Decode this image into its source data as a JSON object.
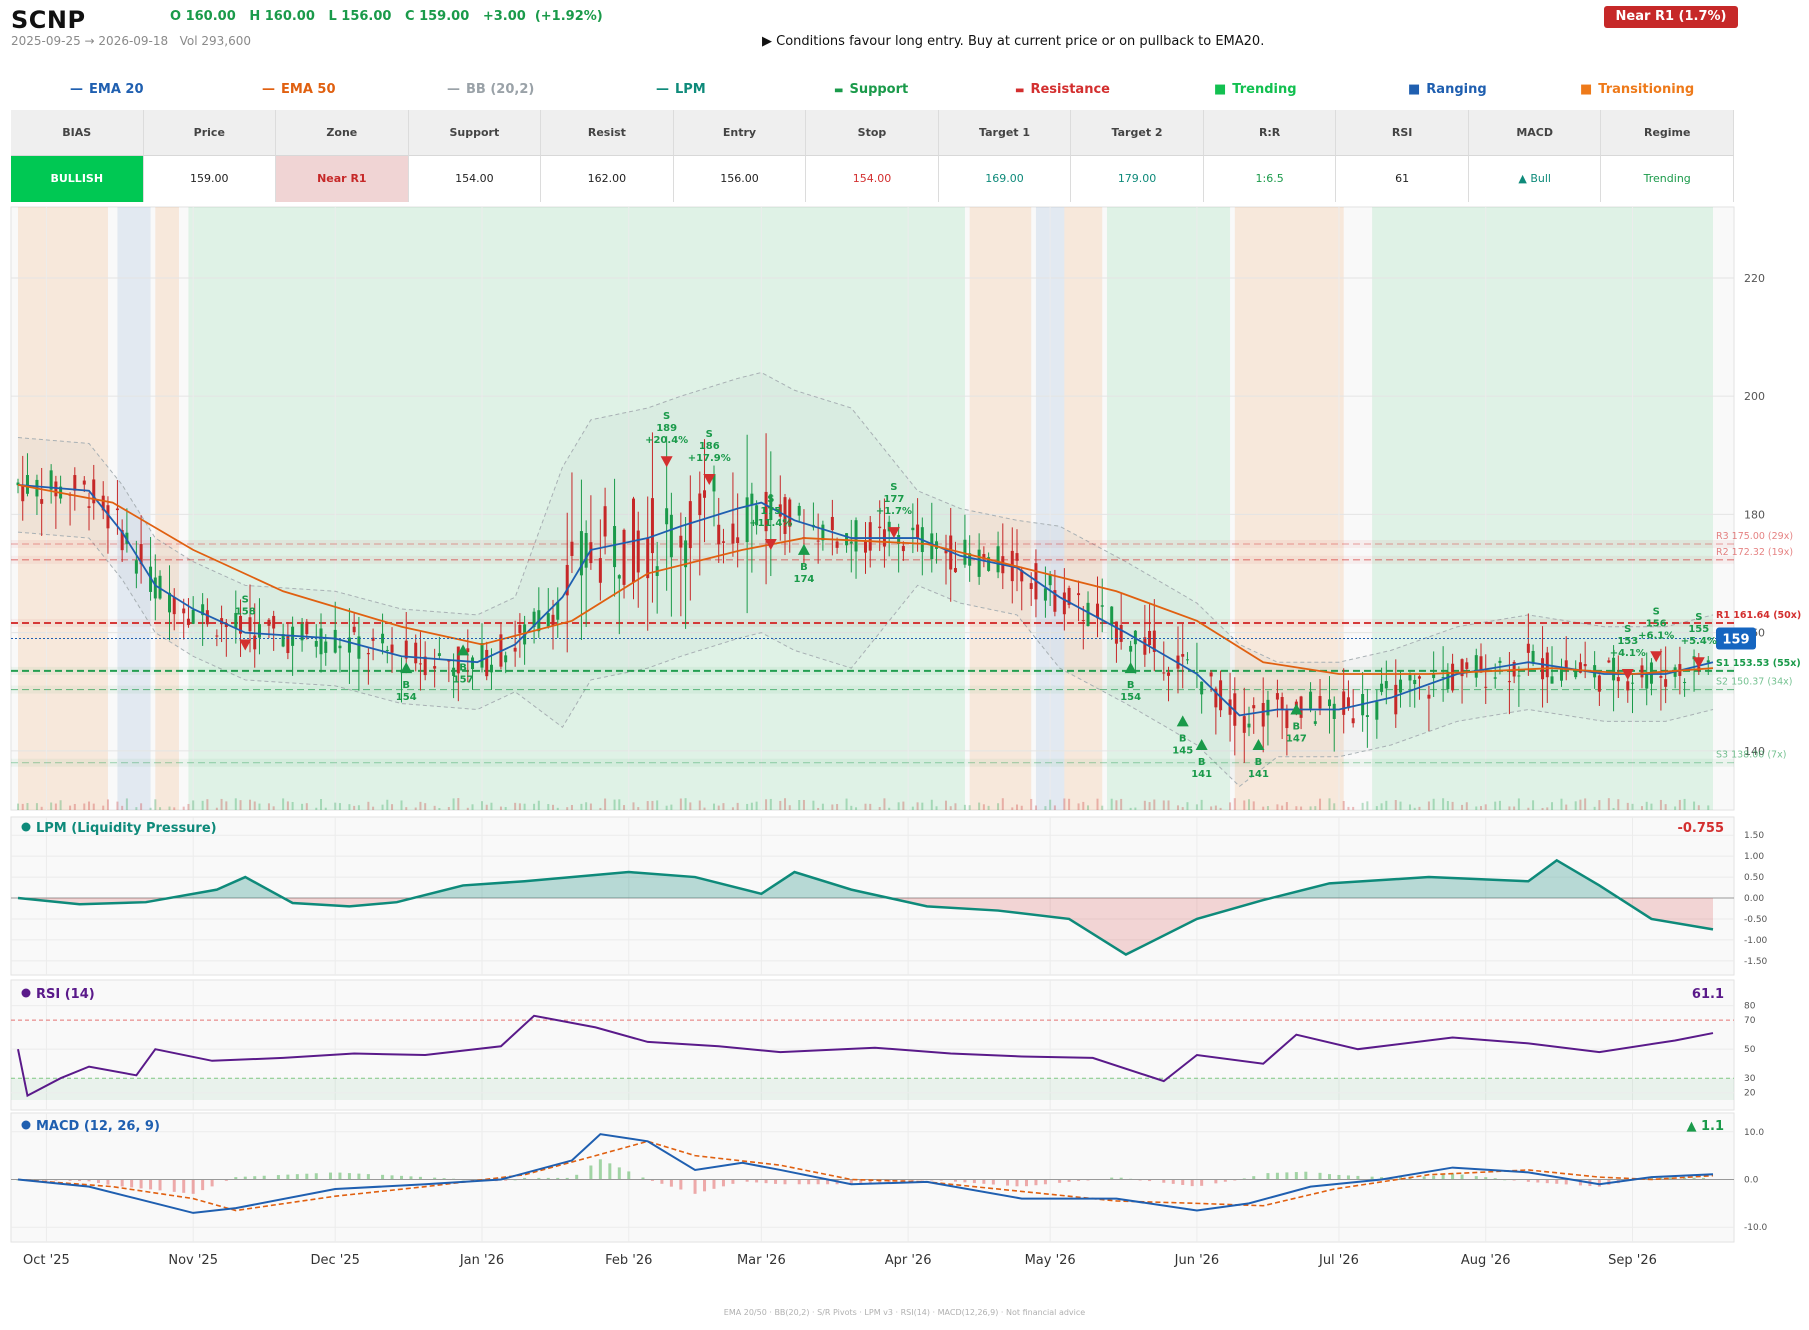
{
  "header": {
    "ticker": "SCNP",
    "ohlc_text": "O 160.00   H 160.00   L 156.00   C 159.00   +3.00  (+1.92%)",
    "range_text": "2025-09-25 → 2026-09-18   Vol 293,600",
    "advice_text": "▶  Conditions favour long entry. Buy at current price or on pullback to EMA20.",
    "near_badge": "Near R1  (1.7%)"
  },
  "legend": [
    {
      "label": "EMA 20",
      "color": "#1f5fb0",
      "marker": "line"
    },
    {
      "label": "EMA 50",
      "color": "#e06010",
      "marker": "line"
    },
    {
      "label": "BB (20,2)",
      "color": "#9aa2a8",
      "marker": "line"
    },
    {
      "label": "LPM",
      "color": "#0e8a7a",
      "marker": "line"
    },
    {
      "label": "Support",
      "color": "#1a9a4a",
      "marker": "dash"
    },
    {
      "label": "Resistance",
      "color": "#d32f2f",
      "marker": "dash"
    },
    {
      "label": "Trending",
      "color": "#12c050",
      "marker": "square"
    },
    {
      "label": "Ranging",
      "color": "#1f5fb0",
      "marker": "square"
    },
    {
      "label": "Transitioning",
      "color": "#ee7a1a",
      "marker": "square"
    }
  ],
  "summary_table": {
    "headers": [
      "BIAS",
      "Price",
      "Zone",
      "Support",
      "Resist",
      "Entry",
      "Stop",
      "Target 1",
      "Target 2",
      "R:R",
      "RSI",
      "MACD",
      "Regime"
    ],
    "values": [
      "BULLISH",
      "159.00",
      "Near R1",
      "154.00",
      "162.00",
      "156.00",
      "154.00",
      "169.00",
      "179.00",
      "1:6.5",
      "61",
      "▲ Bull",
      "Trending"
    ],
    "colors": {
      "bias_bg": "#00c853",
      "zone_bg": "#f0d4d4",
      "zone_fg": "#c62828",
      "stop": "#d32f2f",
      "target": "#0e8a7a",
      "rr": "#1a9a4a",
      "macd": "#0e8a7a",
      "regime": "#1a9a4a"
    }
  },
  "chart_data": [
    {
      "type": "candlestick",
      "title": "",
      "ylim": [
        130,
        232
      ],
      "yticks": [
        140,
        160,
        180,
        200,
        220
      ],
      "x_months": [
        "Oct '25",
        "Nov '25",
        "Dec '25",
        "Jan '26",
        "Feb '26",
        "Mar '26",
        "Apr '26",
        "May '26",
        "Jun '26",
        "Jul '26",
        "Aug '26",
        "Sep '26"
      ],
      "last_price_label": "159",
      "levels": [
        {
          "label": "R3 175.00 (29x)",
          "value": 175.0,
          "kind": "resistance"
        },
        {
          "label": "R2 172.32 (19x)",
          "value": 172.32,
          "kind": "resistance"
        },
        {
          "label": "R1 161.64 (50x)",
          "value": 161.64,
          "kind": "resistance"
        },
        {
          "label": "S1 153.53 (55x)",
          "value": 153.53,
          "kind": "support"
        },
        {
          "label": "S2 150.37 (34x)",
          "value": 150.37,
          "kind": "support"
        },
        {
          "label": "S3 138.00 (7x)",
          "value": 138.0,
          "kind": "support"
        }
      ],
      "current_price": 159.0,
      "regimes": [
        {
          "from": "2025-09-25",
          "to": "2025-10-14",
          "regime": "Transitioning"
        },
        {
          "from": "2025-10-16",
          "to": "2025-10-23",
          "regime": "Ranging"
        },
        {
          "from": "2025-10-24",
          "to": "2025-10-29",
          "regime": "Transitioning"
        },
        {
          "from": "2025-10-31",
          "to": "2026-04-13",
          "regime": "Trending"
        },
        {
          "from": "2026-04-14",
          "to": "2026-04-27",
          "regime": "Transitioning"
        },
        {
          "from": "2026-04-28",
          "to": "2026-05-04",
          "regime": "Ranging"
        },
        {
          "from": "2026-05-04",
          "to": "2026-05-12",
          "regime": "Transitioning"
        },
        {
          "from": "2026-05-13",
          "to": "2026-06-08",
          "regime": "Trending"
        },
        {
          "from": "2026-06-09",
          "to": "2026-07-02",
          "regime": "Transitioning"
        },
        {
          "from": "2026-07-08",
          "to": "2026-09-18",
          "regime": "Trending"
        }
      ],
      "signals": [
        {
          "date": "2025-11-12",
          "side": "S",
          "price": 158,
          "note": ""
        },
        {
          "date": "2025-12-16",
          "side": "B",
          "price": 154,
          "note": ""
        },
        {
          "date": "2025-12-28",
          "side": "B",
          "price": 157,
          "note": ""
        },
        {
          "date": "2026-02-09",
          "side": "S",
          "price": 189,
          "note": "+20.4%"
        },
        {
          "date": "2026-02-18",
          "side": "S",
          "price": 186,
          "note": "+17.9%"
        },
        {
          "date": "2026-03-03",
          "side": "S",
          "price": 175,
          "note": "+11.4%"
        },
        {
          "date": "2026-03-10",
          "side": "B",
          "price": 174,
          "note": ""
        },
        {
          "date": "2026-03-29",
          "side": "S",
          "price": 177,
          "note": "+1.7%"
        },
        {
          "date": "2026-05-18",
          "side": "B",
          "price": 154,
          "note": ""
        },
        {
          "date": "2026-05-29",
          "side": "B",
          "price": 145,
          "note": ""
        },
        {
          "date": "2026-06-02",
          "side": "B",
          "price": 141,
          "note": ""
        },
        {
          "date": "2026-06-14",
          "side": "B",
          "price": 141,
          "note": ""
        },
        {
          "date": "2026-06-22",
          "side": "B",
          "price": 147,
          "note": ""
        },
        {
          "date": "2026-08-31",
          "side": "S",
          "price": 153,
          "note": "+4.1%"
        },
        {
          "date": "2026-09-06",
          "side": "S",
          "price": 156,
          "note": "+6.1%"
        },
        {
          "date": "2026-09-15",
          "side": "S",
          "price": 155,
          "note": "+5.4%"
        }
      ],
      "series": [
        {
          "name": "EMA 20",
          "points": [
            [
              "2025-09-25",
              185
            ],
            [
              "2025-10-10",
              184
            ],
            [
              "2025-10-17",
              177
            ],
            [
              "2025-10-24",
              168
            ],
            [
              "2025-11-01",
              164
            ],
            [
              "2025-11-12",
              160
            ],
            [
              "2025-12-01",
              159
            ],
            [
              "2025-12-15",
              156
            ],
            [
              "2025-12-31",
              155
            ],
            [
              "2026-01-08",
              158
            ],
            [
              "2026-01-18",
              166
            ],
            [
              "2026-01-24",
              174
            ],
            [
              "2026-02-05",
              176
            ],
            [
              "2026-02-12",
              178
            ],
            [
              "2026-02-24",
              181
            ],
            [
              "2026-03-01",
              182
            ],
            [
              "2026-03-08",
              179
            ],
            [
              "2026-03-20",
              176
            ],
            [
              "2026-04-03",
              176
            ],
            [
              "2026-04-12",
              173
            ],
            [
              "2026-04-24",
              171
            ],
            [
              "2026-05-03",
              166
            ],
            [
              "2026-05-17",
              160
            ],
            [
              "2026-06-01",
              153
            ],
            [
              "2026-06-10",
              146
            ],
            [
              "2026-06-18",
              147
            ],
            [
              "2026-07-01",
              147
            ],
            [
              "2026-07-12",
              149
            ],
            [
              "2026-07-26",
              153
            ],
            [
              "2026-08-10",
              155
            ],
            [
              "2026-08-26",
              153
            ],
            [
              "2026-09-08",
              153
            ],
            [
              "2026-09-18",
              155
            ]
          ]
        },
        {
          "name": "EMA 50",
          "points": [
            [
              "2025-09-25",
              185
            ],
            [
              "2025-10-15",
              182
            ],
            [
              "2025-11-01",
              174
            ],
            [
              "2025-11-20",
              167
            ],
            [
              "2025-12-15",
              161
            ],
            [
              "2026-01-01",
              158
            ],
            [
              "2026-01-20",
              162
            ],
            [
              "2026-02-05",
              170
            ],
            [
              "2026-02-25",
              174
            ],
            [
              "2026-03-10",
              176
            ],
            [
              "2026-04-05",
              175
            ],
            [
              "2026-04-25",
              171
            ],
            [
              "2026-05-15",
              167
            ],
            [
              "2026-06-01",
              162
            ],
            [
              "2026-06-15",
              155
            ],
            [
              "2026-07-01",
              153
            ],
            [
              "2026-07-20",
              153
            ],
            [
              "2026-08-15",
              154
            ],
            [
              "2026-09-01",
              153
            ],
            [
              "2026-09-18",
              154
            ]
          ]
        },
        {
          "name": "LPM",
          "ylim": [
            -1.6,
            1.6
          ],
          "yticks": [
            1.5,
            1.0,
            0.5,
            0.0,
            -0.5,
            -1.0,
            -1.5
          ],
          "last_value_label": "-0.755",
          "points": [
            [
              "2025-09-25",
              0.0
            ],
            [
              "2025-10-08",
              -0.15
            ],
            [
              "2025-10-22",
              -0.1
            ],
            [
              "2025-11-06",
              0.2
            ],
            [
              "2025-11-12",
              0.5
            ],
            [
              "2025-11-22",
              -0.12
            ],
            [
              "2025-12-04",
              -0.2
            ],
            [
              "2025-12-14",
              -0.1
            ],
            [
              "2025-12-28",
              0.3
            ],
            [
              "2026-01-10",
              0.4
            ],
            [
              "2026-02-01",
              0.62
            ],
            [
              "2026-02-15",
              0.5
            ],
            [
              "2026-03-01",
              0.1
            ],
            [
              "2026-03-08",
              0.62
            ],
            [
              "2026-03-20",
              0.2
            ],
            [
              "2026-04-05",
              -0.2
            ],
            [
              "2026-04-20",
              -0.3
            ],
            [
              "2026-05-05",
              -0.5
            ],
            [
              "2026-05-17",
              -1.35
            ],
            [
              "2026-06-01",
              -0.5
            ],
            [
              "2026-06-15",
              -0.05
            ],
            [
              "2026-06-29",
              0.35
            ],
            [
              "2026-07-20",
              0.5
            ],
            [
              "2026-08-10",
              0.4
            ],
            [
              "2026-08-16",
              0.9
            ],
            [
              "2026-08-25",
              0.3
            ],
            [
              "2026-09-05",
              -0.5
            ],
            [
              "2026-09-18",
              -0.75
            ]
          ]
        },
        {
          "name": "RSI (14)",
          "ylim": [
            15,
            88
          ],
          "yticks": [
            80,
            70,
            50,
            30,
            20
          ],
          "last_value_label": "61.1",
          "points": [
            [
              "2025-09-25",
              50
            ],
            [
              "2025-09-27",
              18
            ],
            [
              "2025-10-04",
              30
            ],
            [
              "2025-10-10",
              38
            ],
            [
              "2025-10-20",
              32
            ],
            [
              "2025-10-24",
              50
            ],
            [
              "2025-11-05",
              42
            ],
            [
              "2025-11-20",
              44
            ],
            [
              "2025-12-05",
              47
            ],
            [
              "2025-12-20",
              46
            ],
            [
              "2026-01-05",
              52
            ],
            [
              "2026-01-12",
              73
            ],
            [
              "2026-01-25",
              65
            ],
            [
              "2026-02-05",
              55
            ],
            [
              "2026-02-20",
              52
            ],
            [
              "2026-03-05",
              48
            ],
            [
              "2026-03-25",
              51
            ],
            [
              "2026-04-10",
              47
            ],
            [
              "2026-04-25",
              45
            ],
            [
              "2026-05-10",
              44
            ],
            [
              "2026-05-25",
              28
            ],
            [
              "2026-06-01",
              46
            ],
            [
              "2026-06-15",
              40
            ],
            [
              "2026-06-22",
              60
            ],
            [
              "2026-07-05",
              50
            ],
            [
              "2026-07-25",
              58
            ],
            [
              "2026-08-10",
              54
            ],
            [
              "2026-08-25",
              48
            ],
            [
              "2026-09-10",
              56
            ],
            [
              "2026-09-18",
              61.1
            ]
          ]
        },
        {
          "name": "MACD (12, 26, 9)",
          "ylim": [
            -11,
            11
          ],
          "yticks": [
            10.0,
            0.0,
            -10.0
          ],
          "last_value_label": "▲ 1.1",
          "points": [
            [
              "2025-09-25",
              0
            ],
            [
              "2025-10-10",
              -1.5
            ],
            [
              "2025-10-20",
              -4
            ],
            [
              "2025-11-01",
              -7
            ],
            [
              "2025-11-10",
              -6
            ],
            [
              "2025-12-01",
              -2
            ],
            [
              "2025-12-20",
              -1
            ],
            [
              "2026-01-05",
              0
            ],
            [
              "2026-01-20",
              4
            ],
            [
              "2026-01-26",
              9.5
            ],
            [
              "2026-02-05",
              8
            ],
            [
              "2026-02-15",
              2
            ],
            [
              "2026-02-25",
              3.5
            ],
            [
              "2026-03-05",
              2
            ],
            [
              "2026-03-20",
              -1
            ],
            [
              "2026-04-05",
              -0.5
            ],
            [
              "2026-04-25",
              -4
            ],
            [
              "2026-05-15",
              -4
            ],
            [
              "2026-06-01",
              -6.5
            ],
            [
              "2026-06-12",
              -5
            ],
            [
              "2026-06-25",
              -1.5
            ],
            [
              "2026-07-10",
              0
            ],
            [
              "2026-07-25",
              2.5
            ],
            [
              "2026-08-10",
              1.5
            ],
            [
              "2026-08-25",
              -1
            ],
            [
              "2026-09-05",
              0.5
            ],
            [
              "2026-09-18",
              1.1
            ]
          ]
        },
        {
          "name": "Signal",
          "points": [
            [
              "2025-09-25",
              0
            ],
            [
              "2025-10-15",
              -1.5
            ],
            [
              "2025-11-01",
              -4
            ],
            [
              "2025-11-10",
              -6.5
            ],
            [
              "2025-12-01",
              -3.5
            ],
            [
              "2025-12-20",
              -1.5
            ],
            [
              "2026-01-10",
              1
            ],
            [
              "2026-01-25",
              5
            ],
            [
              "2026-02-05",
              8
            ],
            [
              "2026-02-15",
              5
            ],
            [
              "2026-03-05",
              3
            ],
            [
              "2026-03-20",
              0
            ],
            [
              "2026-04-05",
              -0.5
            ],
            [
              "2026-04-25",
              -2.5
            ],
            [
              "2026-05-15",
              -4.5
            ],
            [
              "2026-06-01",
              -5
            ],
            [
              "2026-06-15",
              -5.5
            ],
            [
              "2026-06-30",
              -2
            ],
            [
              "2026-07-20",
              1
            ],
            [
              "2026-08-10",
              2
            ],
            [
              "2026-08-25",
              0.5
            ],
            [
              "2026-09-05",
              0
            ],
            [
              "2026-09-18",
              0.8
            ]
          ]
        }
      ]
    }
  ],
  "footer_text": "EMA 20/50  ·  BB(20,2)  ·  S/R Pivots  ·  LPM v3  ·  RSI(14)  ·  MACD(12,26,9)  ·  Not financial advice",
  "panel_labels": {
    "lpm": "LPM (Liquidity Pressure)",
    "rsi": "RSI (14)",
    "macd": "MACD (12, 26, 9)"
  }
}
